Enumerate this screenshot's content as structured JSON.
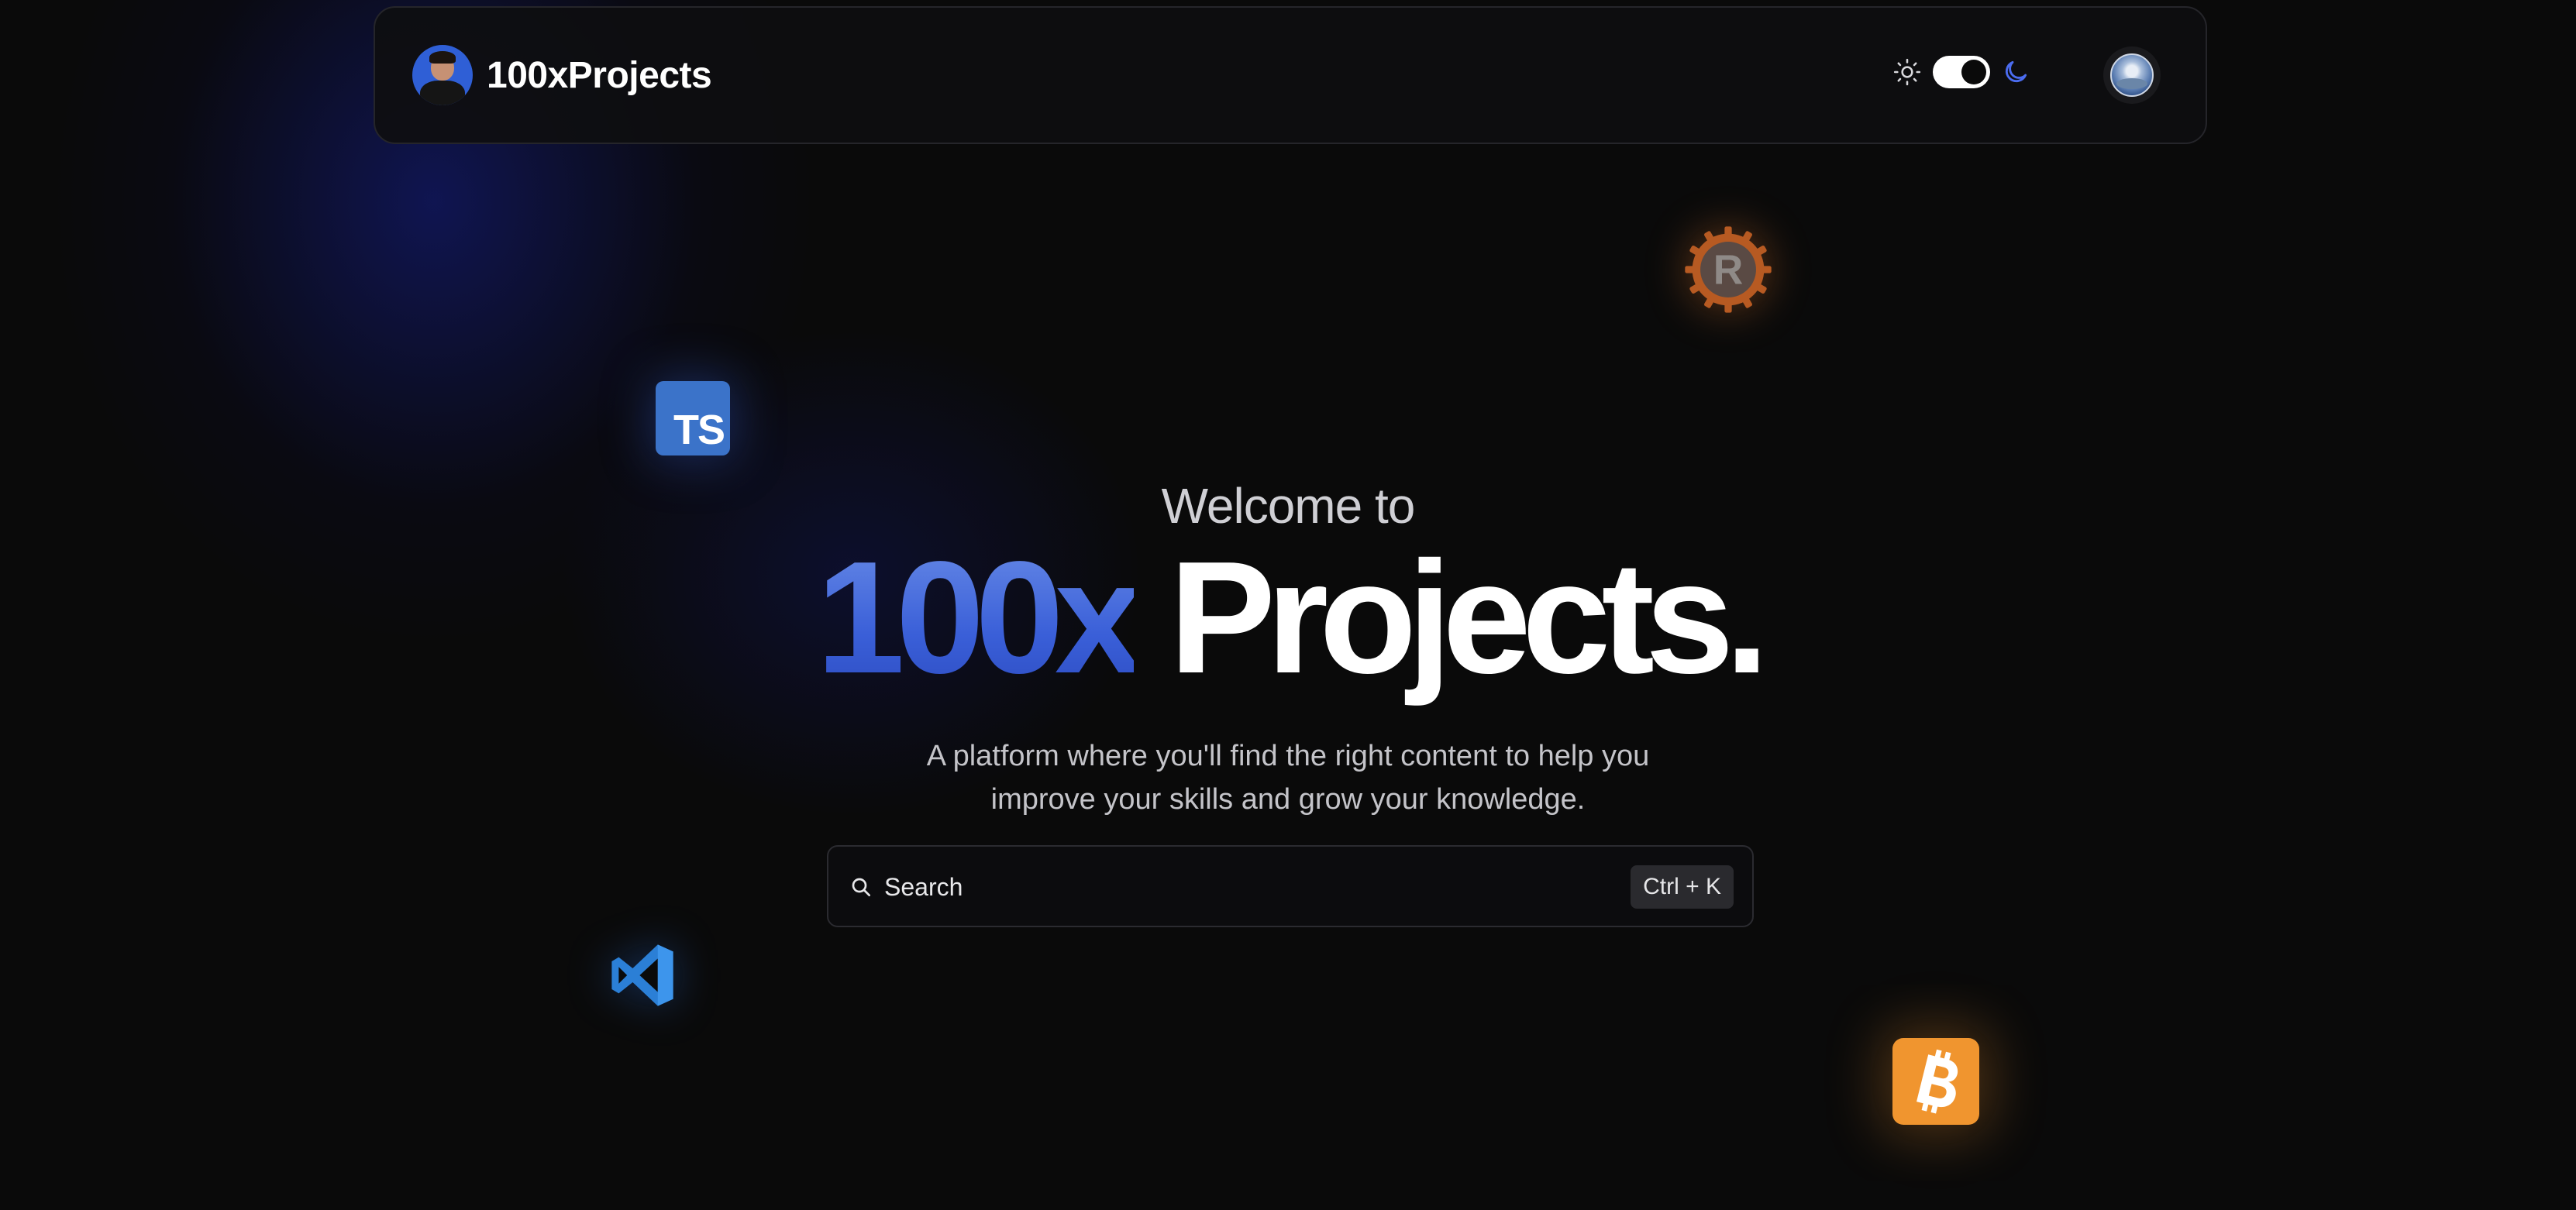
{
  "navbar": {
    "brand_name": "100xProjects",
    "brand_avatar_icon": "profile-photo-icon",
    "theme": {
      "sun_icon": "sun-icon",
      "moon_icon": "moon-icon",
      "mode": "dark"
    },
    "user_avatar_icon": "user-avatar-icon"
  },
  "hero": {
    "welcome": "Welcome to",
    "title_accent": "100x",
    "title_main": "Projects.",
    "subtitle_line1": "A platform where you'll find the right content to help you",
    "subtitle_line2": "improve your skills and grow your knowledge."
  },
  "search": {
    "placeholder": "Search",
    "shortcut": "Ctrl + K",
    "icon": "search-icon"
  },
  "floating_icons": {
    "typescript": "TS",
    "rust": "R",
    "vscode": "vscode-icon",
    "bitcoin": "bitcoin-icon"
  },
  "colors": {
    "background": "#0a0a0a",
    "accent_blue": "#3a5fd8",
    "moon_blue": "#4b6cf0",
    "typescript_blue": "#3b73c9",
    "rust_orange": "#b75a22",
    "bitcoin_orange": "#f0952f"
  }
}
